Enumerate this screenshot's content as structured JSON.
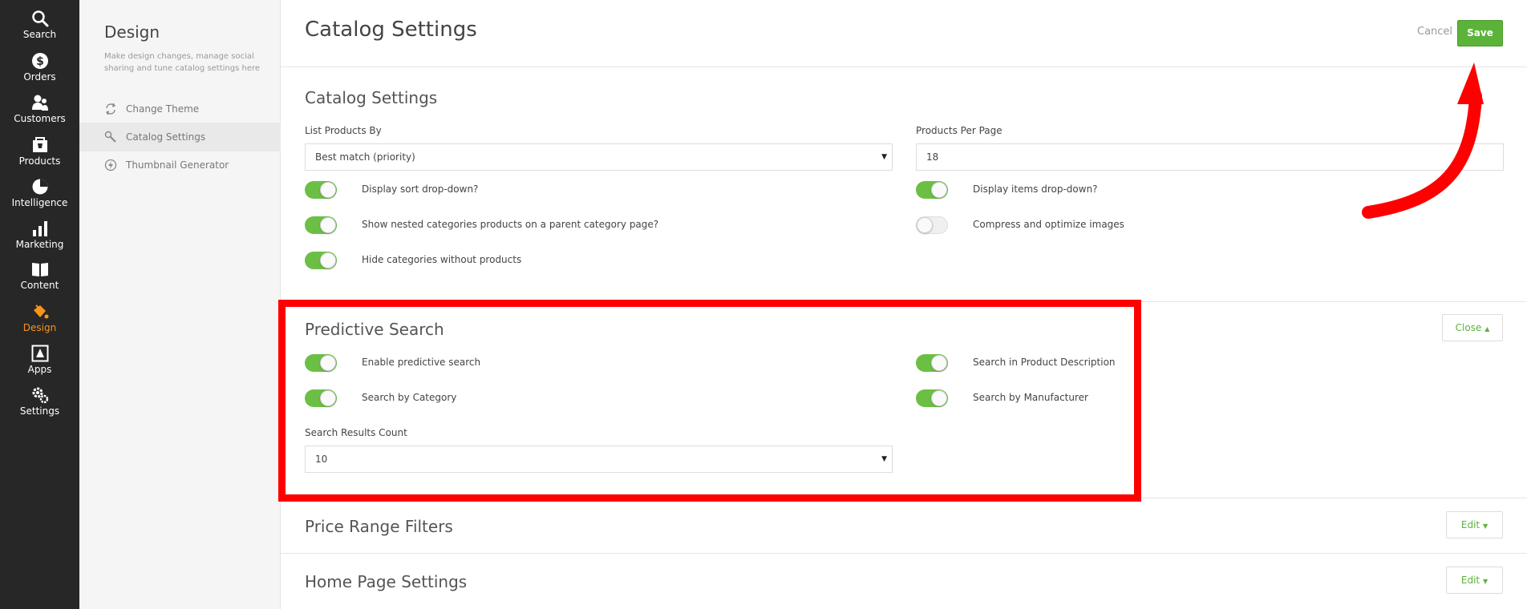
{
  "nav": {
    "items": [
      {
        "label": "Search",
        "icon": "search-icon"
      },
      {
        "label": "Orders",
        "icon": "dollar-icon"
      },
      {
        "label": "Customers",
        "icon": "customers-icon"
      },
      {
        "label": "Products",
        "icon": "products-icon"
      },
      {
        "label": "Intelligence",
        "icon": "pie-chart-icon"
      },
      {
        "label": "Marketing",
        "icon": "bar-chart-icon"
      },
      {
        "label": "Content",
        "icon": "book-icon"
      },
      {
        "label": "Design",
        "icon": "paint-bucket-icon"
      },
      {
        "label": "Apps",
        "icon": "apps-icon"
      },
      {
        "label": "Settings",
        "icon": "gears-icon"
      }
    ],
    "active_color": "#f7941d"
  },
  "sidebar": {
    "title": "Design",
    "description": "Make design changes, manage social sharing and tune catalog settings here",
    "items": [
      {
        "label": "Change Theme",
        "icon": "refresh-icon"
      },
      {
        "label": "Catalog Settings",
        "icon": "wrench-icon"
      },
      {
        "label": "Thumbnail Generator",
        "icon": "lightning-icon"
      }
    ]
  },
  "header": {
    "title": "Catalog Settings",
    "cancel_label": "Cancel",
    "save_label": "Save"
  },
  "catalog": {
    "title": "Catalog Settings",
    "list_by_label": "List Products By",
    "list_by_value": "Best match (priority)",
    "per_page_label": "Products Per Page",
    "per_page_value": "18",
    "toggles_left": [
      {
        "label": "Display sort drop-down?",
        "on": true
      },
      {
        "label": "Show nested categories products on a parent category page?",
        "on": true
      },
      {
        "label": "Hide categories without products",
        "on": true
      }
    ],
    "toggles_right": [
      {
        "label": "Display items drop-down?",
        "on": true
      },
      {
        "label": "Compress and optimize images",
        "on": false
      }
    ]
  },
  "predictive": {
    "title": "Predictive Search",
    "close_label": "Close",
    "toggles_left": [
      {
        "label": "Enable predictive search",
        "on": true
      },
      {
        "label": "Search by Category",
        "on": true
      }
    ],
    "toggles_right": [
      {
        "label": "Search in Product Description",
        "on": true
      },
      {
        "label": "Search by Manufacturer",
        "on": true
      }
    ],
    "results_count_label": "Search Results Count",
    "results_count_value": "10"
  },
  "price_range": {
    "title": "Price Range Filters",
    "edit_label": "Edit"
  },
  "home_page": {
    "title": "Home Page Settings",
    "edit_label": "Edit"
  },
  "colors": {
    "accent_green": "#5cb33a",
    "toggle_on": "#6cbf45",
    "annotation_red": "#ff0000"
  }
}
